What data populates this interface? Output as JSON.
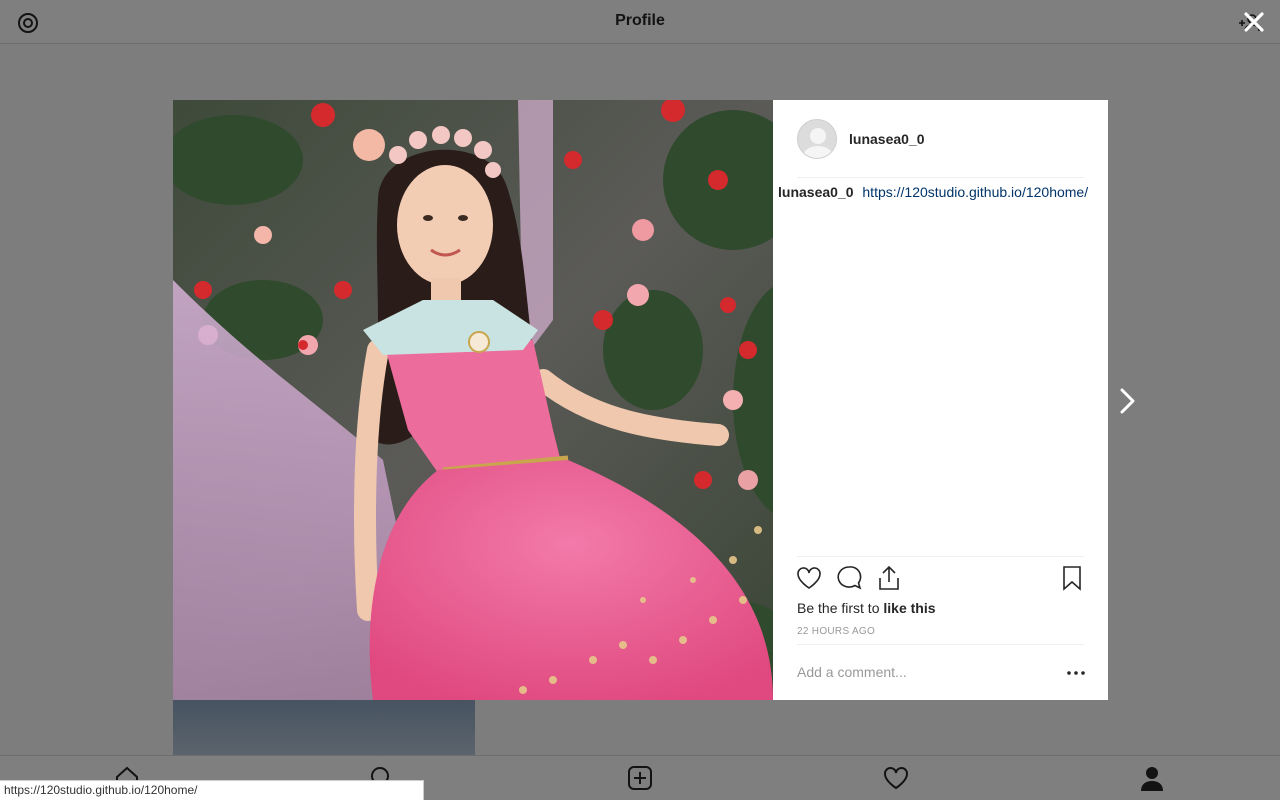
{
  "header": {
    "title": "Profile"
  },
  "post": {
    "username": "lunasea0_0",
    "caption_user": "lunasea0_0",
    "caption_link": "https://120studio.github.io/120home/",
    "likes_prefix": "Be the first to ",
    "likes_action": "like this",
    "timestamp": "22 HOURS AGO",
    "comment_placeholder": "Add a comment...",
    "photo_description_icon": "portrait-photo"
  },
  "status_bar": {
    "url": "https://120studio.github.io/120home/"
  },
  "icons": {
    "settings": "settings-icon",
    "close": "close-icon",
    "next": "chevron-right-icon",
    "like": "heart-icon",
    "comment": "comment-icon",
    "share": "share-icon",
    "save": "bookmark-icon",
    "more": "more-options-icon"
  },
  "colors": {
    "link": "#003569",
    "muted": "#999999",
    "text": "#262626"
  }
}
